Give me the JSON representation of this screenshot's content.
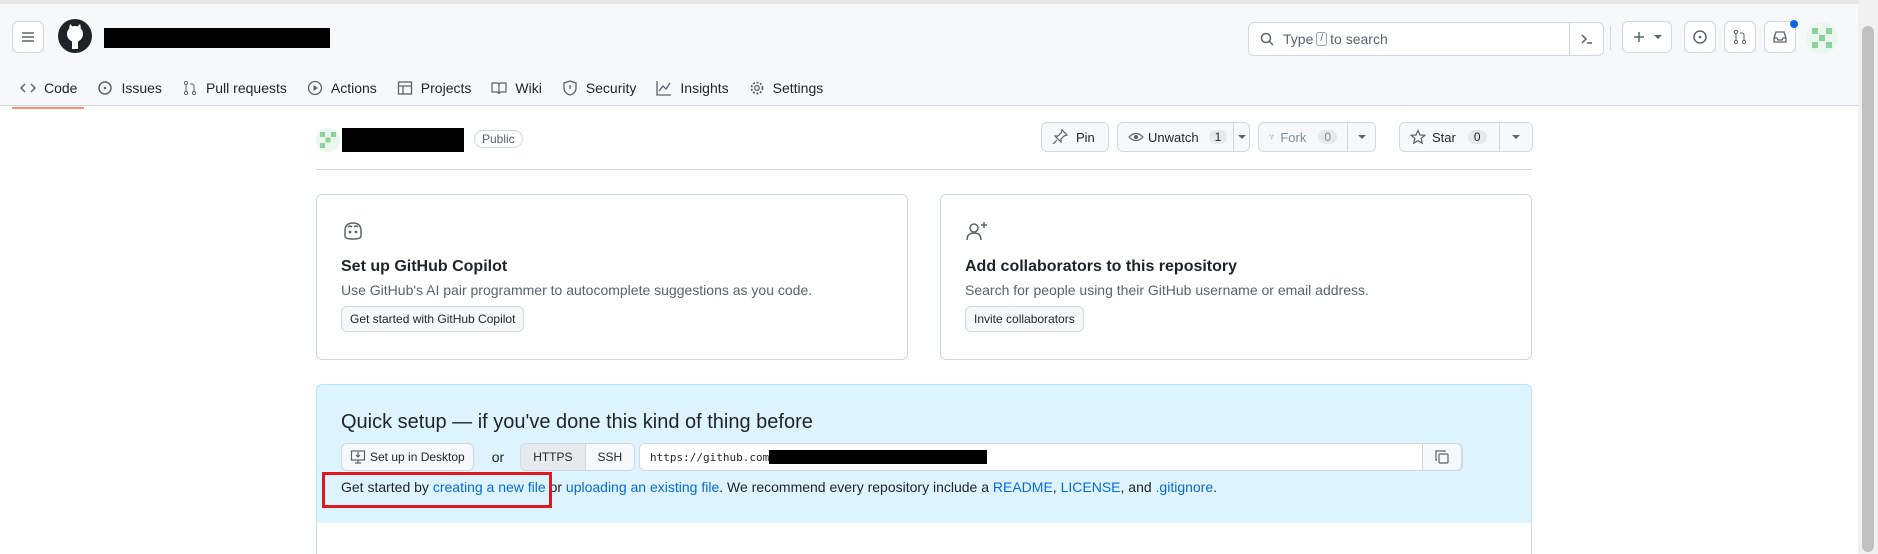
{
  "header": {
    "search_prefix": "Type",
    "search_key": "/",
    "search_suffix": "to search",
    "notification_dot_color": "#0969da"
  },
  "tabs": [
    {
      "label": "Code",
      "icon": "code-icon"
    },
    {
      "label": "Issues",
      "icon": "issue-opened-icon"
    },
    {
      "label": "Pull requests",
      "icon": "git-pull-request-icon"
    },
    {
      "label": "Actions",
      "icon": "play-icon"
    },
    {
      "label": "Projects",
      "icon": "table-icon"
    },
    {
      "label": "Wiki",
      "icon": "book-icon"
    },
    {
      "label": "Security",
      "icon": "shield-icon"
    },
    {
      "label": "Insights",
      "icon": "graph-icon"
    },
    {
      "label": "Settings",
      "icon": "gear-icon"
    }
  ],
  "repo": {
    "visibility": "Public",
    "pin_label": "Pin",
    "unwatch_label": "Unwatch",
    "watch_count": "1",
    "fork_label": "Fork",
    "fork_count": "0",
    "star_label": "Star",
    "star_count": "0"
  },
  "cards": {
    "copilot": {
      "title": "Set up GitHub Copilot",
      "desc": "Use GitHub's AI pair programmer to autocomplete suggestions as you code.",
      "button": "Get started with GitHub Copilot"
    },
    "collab": {
      "title": "Add collaborators to this repository",
      "desc": "Search for people using their GitHub username or email address.",
      "button": "Invite collaborators"
    }
  },
  "quick_setup": {
    "title": "Quick setup — if you've done this kind of thing before",
    "desktop_button": "Set up in Desktop",
    "or": "or",
    "https": "HTTPS",
    "ssh": "SSH",
    "url": "https://github.com",
    "line_start": "Get started by",
    "link_new_file": "creating a new file",
    "line_or": "or",
    "link_upload": "uploading an existing file",
    "line_mid": ". We recommend every repository include a",
    "link_readme": "README",
    "comma1": ",",
    "link_license": "LICENSE",
    "line_and": ", and",
    "link_gitignore": ".gitignore",
    "line_end": "."
  }
}
